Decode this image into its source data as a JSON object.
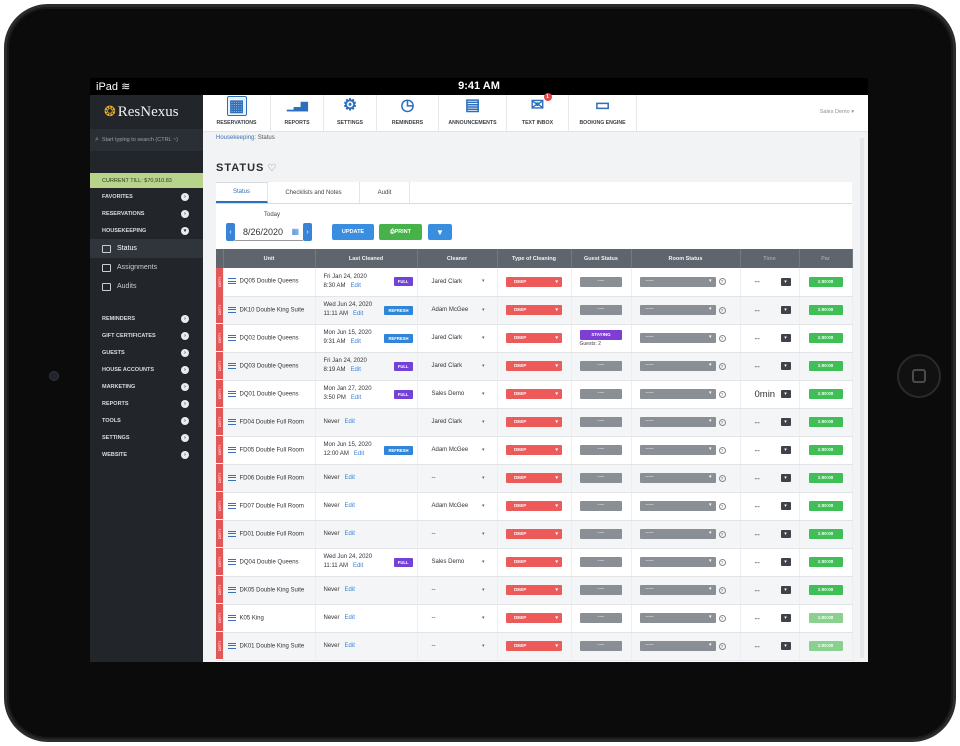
{
  "device": {
    "carrier": "iPad",
    "clock": "9:41 AM"
  },
  "sidebar": {
    "logo": "ResNexus",
    "search_placeholder": "Start typing to search (CTRL ~)",
    "current_till": "CURRENT TILL: $70,910.83",
    "sections_top": [
      {
        "label": "FAVORITES",
        "state": "›"
      },
      {
        "label": "RESERVATIONS",
        "state": "›"
      },
      {
        "label": "HOUSEKEEPING",
        "state": "▾"
      }
    ],
    "sub_items": [
      {
        "label": "Status",
        "active": true
      },
      {
        "label": "Assignments",
        "active": false
      },
      {
        "label": "Audits",
        "active": false
      }
    ],
    "sections_bottom": [
      {
        "label": "REMINDERS",
        "state": "›"
      },
      {
        "label": "GIFT CERTIFICATES",
        "state": "›"
      },
      {
        "label": "GUESTS",
        "state": "›"
      },
      {
        "label": "HOUSE ACCOUNTS",
        "state": "›"
      },
      {
        "label": "MARKETING",
        "state": "›"
      },
      {
        "label": "REPORTS",
        "state": "›"
      },
      {
        "label": "TOOLS",
        "state": "›"
      },
      {
        "label": "SETTINGS",
        "state": "›"
      },
      {
        "label": "WEBSITE",
        "state": "›"
      }
    ]
  },
  "topnav": {
    "items": [
      {
        "label": "RESERVATIONS",
        "icon": "calendar-grid-icon"
      },
      {
        "label": "REPORTS",
        "icon": "bar-chart-icon"
      },
      {
        "label": "SETTINGS",
        "icon": "gear-icon"
      },
      {
        "label": "REMINDERS",
        "icon": "clock-icon"
      },
      {
        "label": "ANNOUNCEMENTS",
        "icon": "newspaper-icon"
      },
      {
        "label": "TEXT INBOX",
        "icon": "chat-bubbles-icon",
        "badge": "1"
      },
      {
        "label": "BOOKING ENGINE",
        "icon": "laptop-icon"
      }
    ],
    "user": "Sales Demo"
  },
  "breadcrumb": {
    "parent": "Housekeeping",
    "current": "Status"
  },
  "page": {
    "title": "STATUS"
  },
  "tabs": [
    "Status",
    "Checklists and Notes",
    "Audit"
  ],
  "controls": {
    "date_label": "Today",
    "date_value": "8/26/2020",
    "update": "UPDATE",
    "print": "PRINT"
  },
  "table": {
    "headers": [
      "Unit",
      "Last Cleaned",
      "Cleaner",
      "Type of Cleaning",
      "Guest Status",
      "Room Status",
      "Time",
      "Par"
    ],
    "dirty_label": "DIRTY",
    "edit_label": "Edit",
    "rows": [
      {
        "unit": "DQ05 Double Queens",
        "lc_date": "Fri Jan 24, 2020",
        "lc_time": "8:30 AM",
        "tag": "FULL",
        "cleaner": "Jared Clark",
        "cleaning": "DEEP",
        "guest": "----",
        "guest_sub": "",
        "room": "-----",
        "time": "--",
        "par": "1:00:00"
      },
      {
        "unit": "DK10 Double King Suite",
        "lc_date": "Wed Jun 24, 2020",
        "lc_time": "11:11 AM",
        "tag": "REFRESH",
        "cleaner": "Adam McGee",
        "cleaning": "DEEP",
        "guest": "----",
        "guest_sub": "",
        "room": "-----",
        "time": "--",
        "par": "1:00:00"
      },
      {
        "unit": "DQ02 Double Queens",
        "lc_date": "Mon Jun 15, 2020",
        "lc_time": "9:31 AM",
        "tag": "REFRESH",
        "cleaner": "Jared Clark",
        "cleaning": "DEEP",
        "guest": "STAYING",
        "guest_sub": "Guests: 2",
        "room": "-----",
        "time": "--",
        "par": "1:00:00"
      },
      {
        "unit": "DQ03 Double Queens",
        "lc_date": "Fri Jan 24, 2020",
        "lc_time": "8:19 AM",
        "tag": "FULL",
        "cleaner": "Jared Clark",
        "cleaning": "DEEP",
        "guest": "----",
        "guest_sub": "",
        "room": "-----",
        "time": "--",
        "par": "1:00:00"
      },
      {
        "unit": "DQ01 Double Queens",
        "lc_date": "Mon Jan 27, 2020",
        "lc_time": "3:50 PM",
        "tag": "FULL",
        "cleaner": "Sales Demo",
        "cleaning": "DEEP",
        "guest": "----",
        "guest_sub": "",
        "room": "-----",
        "time": "0min",
        "par": "1:00:00"
      },
      {
        "unit": "FD04 Double Full Room",
        "lc_date": "Never",
        "lc_time": "",
        "tag": "",
        "cleaner": "Jared Clark",
        "cleaning": "DEEP",
        "guest": "----",
        "guest_sub": "",
        "room": "-----",
        "time": "--",
        "par": "1:00:00"
      },
      {
        "unit": "FD05 Double Full Room",
        "lc_date": "Mon Jun 15, 2020",
        "lc_time": "12:00 AM",
        "tag": "REFRESH",
        "cleaner": "Adam McGee",
        "cleaning": "DEEP",
        "guest": "----",
        "guest_sub": "",
        "room": "-----",
        "time": "--",
        "par": "1:00:00"
      },
      {
        "unit": "FD06 Double Full Room",
        "lc_date": "Never",
        "lc_time": "",
        "tag": "",
        "cleaner": "--",
        "cleaning": "DEEP",
        "guest": "----",
        "guest_sub": "",
        "room": "-----",
        "time": "--",
        "par": "1:00:00"
      },
      {
        "unit": "FD07 Double Full Room",
        "lc_date": "Never",
        "lc_time": "",
        "tag": "",
        "cleaner": "Adam McGee",
        "cleaning": "DEEP",
        "guest": "----",
        "guest_sub": "",
        "room": "-----",
        "time": "--",
        "par": "1:00:00"
      },
      {
        "unit": "FD01 Double Full Room",
        "lc_date": "Never",
        "lc_time": "",
        "tag": "",
        "cleaner": "--",
        "cleaning": "DEEP",
        "guest": "----",
        "guest_sub": "",
        "room": "-----",
        "time": "--",
        "par": "1:00:00"
      },
      {
        "unit": "DQ04 Double Queens",
        "lc_date": "Wed Jun 24, 2020",
        "lc_time": "11:11 AM",
        "tag": "FULL",
        "cleaner": "Sales Demo",
        "cleaning": "DEEP",
        "guest": "----",
        "guest_sub": "",
        "room": "-----",
        "time": "--",
        "par": "1:00:00"
      },
      {
        "unit": "DK05 Double King Suite",
        "lc_date": "Never",
        "lc_time": "",
        "tag": "",
        "cleaner": "--",
        "cleaning": "DEEP",
        "guest": "----",
        "guest_sub": "",
        "room": "-----",
        "time": "--",
        "par": "1:00:00"
      },
      {
        "unit": "K05 King",
        "lc_date": "Never",
        "lc_time": "",
        "tag": "",
        "cleaner": "--",
        "cleaning": "DEEP",
        "guest": "----",
        "guest_sub": "",
        "room": "-----",
        "time": "--",
        "par": "1:00:00"
      },
      {
        "unit": "DK01 Double King Suite",
        "lc_date": "Never",
        "lc_time": "",
        "tag": "",
        "cleaner": "--",
        "cleaning": "DEEP",
        "guest": "----",
        "guest_sub": "",
        "room": "-----",
        "time": "--",
        "par": "1:00:00"
      }
    ]
  },
  "colors": {
    "accent": "#3a8ee0",
    "dirty": "#e25757",
    "full_tag": "#7141d8",
    "par": "#3fbf55",
    "sidebar": "#22262b"
  }
}
